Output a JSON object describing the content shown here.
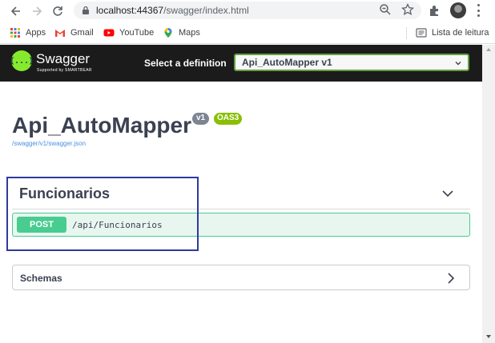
{
  "browser": {
    "url_host": "localhost:44367",
    "url_path": "/swagger/index.html",
    "bookmarks": [
      {
        "label": "Apps",
        "icon": "apps-grid-icon"
      },
      {
        "label": "Gmail",
        "icon": "gmail-icon"
      },
      {
        "label": "YouTube",
        "icon": "youtube-icon"
      },
      {
        "label": "Maps",
        "icon": "maps-pin-icon"
      }
    ],
    "reading_list": "Lista de leitura"
  },
  "topbar": {
    "logo_text": "Swagger",
    "logo_sub": "Supported by SMARTBEAR",
    "logo_glyph": "{...}",
    "definition_label": "Select a definition",
    "definition_selected": "Api_AutoMapper v1"
  },
  "info": {
    "title": "Api_AutoMapper",
    "version_badge": "v1",
    "oas_badge": "OAS3",
    "spec_link": "/swagger/v1/swagger.json"
  },
  "tag": {
    "name": "Funcionarios",
    "operations": [
      {
        "method": "POST",
        "path": "/api/Funcionarios"
      }
    ]
  },
  "schemas": {
    "label": "Schemas"
  },
  "colors": {
    "post_green": "#49cc90",
    "topbar": "#1b1b1b",
    "logo_green": "#85ea2d",
    "highlight_box": "#2f3a9e"
  }
}
